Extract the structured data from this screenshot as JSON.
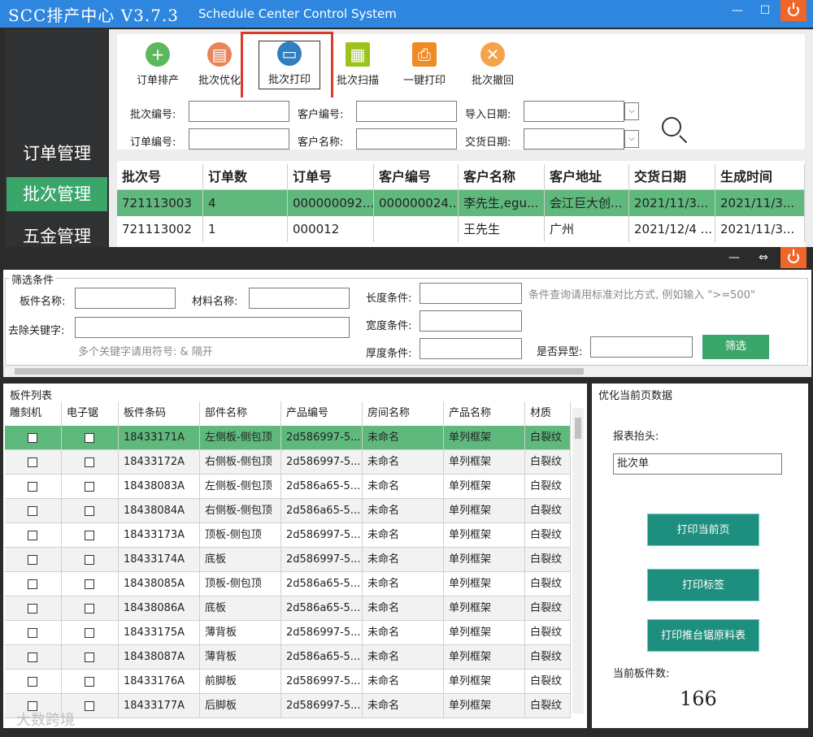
{
  "app": {
    "title": "SCC排产中心 V3.7.3",
    "subtitle": "Schedule Center Control System"
  },
  "sidebar": {
    "items": [
      {
        "label": "订单管理"
      },
      {
        "label": "批次管理"
      },
      {
        "label": "五金管理"
      }
    ]
  },
  "toolbar": {
    "items": [
      {
        "label": "订单排产",
        "icon": "plus-icon",
        "color": "#5cb85c"
      },
      {
        "label": "批次优化",
        "icon": "optimize-icon",
        "color": "#e8845a"
      },
      {
        "label": "批次打印",
        "icon": "monitor-print-icon",
        "color": "#2f7fc1"
      },
      {
        "label": "批次扫描",
        "icon": "barcode-icon",
        "color": "#9bc41e"
      },
      {
        "label": "一键打印",
        "icon": "printer-icon",
        "color": "#f08a24"
      },
      {
        "label": "批次撤回",
        "icon": "cancel-icon",
        "color": "#f4a24c"
      }
    ]
  },
  "search": {
    "batch_no_label": "批次编号:",
    "customer_no_label": "客户编号:",
    "import_date_label": "导入日期:",
    "order_no_label": "订单编号:",
    "customer_name_label": "客户名称:",
    "delivery_date_label": "交货日期:",
    "dropdown_glyph": "⌵"
  },
  "batch_table": {
    "columns": [
      "批次号",
      "订单数",
      "订单号",
      "客户编号",
      "客户名称",
      "客户地址",
      "交货日期",
      "生成时间"
    ],
    "rows": [
      [
        "721113003",
        "4",
        "000000092...",
        "000000024...",
        "李先生,egu...",
        "会江巨大创...",
        "2021/11/3...",
        "2021/11/3..."
      ],
      [
        "721113002",
        "1",
        "000012",
        "",
        "王先生",
        "广州",
        "2021/12/4 ...",
        "2021/11/3..."
      ]
    ]
  },
  "filter": {
    "group_title": "筛选条件",
    "part_name_label": "板件名称:",
    "material_name_label": "材料名称:",
    "remove_keyword_label": "去除关键字:",
    "keyword_hint": "多个关键字请用符号: & 隔开",
    "length_label": "长度条件:",
    "width_label": "宽度条件:",
    "thickness_label": "厚度条件:",
    "condition_hint": "条件查询请用标准对比方式, 例如输入 \">=500\"",
    "is_irregular_label": "是否异型:",
    "filter_button": "筛选"
  },
  "parts_list": {
    "title": "板件列表",
    "columns": [
      "雕刻机",
      "电子锯",
      "板件条码",
      "部件名称",
      "产品编号",
      "房间名称",
      "产品名称",
      "材质"
    ],
    "rows": [
      [
        "18433171A",
        "左侧板-侧包顶",
        "2d586997-5...",
        "未命名",
        "单列框架",
        "白裂纹"
      ],
      [
        "18433172A",
        "右侧板-侧包顶",
        "2d586997-5...",
        "未命名",
        "单列框架",
        "白裂纹"
      ],
      [
        "18438083A",
        "左侧板-侧包顶",
        "2d586a65-5...",
        "未命名",
        "单列框架",
        "白裂纹"
      ],
      [
        "18438084A",
        "右侧板-侧包顶",
        "2d586a65-5...",
        "未命名",
        "单列框架",
        "白裂纹"
      ],
      [
        "18433173A",
        "顶板-侧包顶",
        "2d586997-5...",
        "未命名",
        "单列框架",
        "白裂纹"
      ],
      [
        "18433174A",
        "底板",
        "2d586997-5...",
        "未命名",
        "单列框架",
        "白裂纹"
      ],
      [
        "18438085A",
        "顶板-侧包顶",
        "2d586a65-5...",
        "未命名",
        "单列框架",
        "白裂纹"
      ],
      [
        "18438086A",
        "底板",
        "2d586a65-5...",
        "未命名",
        "单列框架",
        "白裂纹"
      ],
      [
        "18433175A",
        "薄背板",
        "2d586997-5...",
        "未命名",
        "单列框架",
        "白裂纹"
      ],
      [
        "18438087A",
        "薄背板",
        "2d586a65-5...",
        "未命名",
        "单列框架",
        "白裂纹"
      ],
      [
        "18433176A",
        "前脚板",
        "2d586997-5...",
        "未命名",
        "单列框架",
        "白裂纹"
      ],
      [
        "18433177A",
        "后脚板",
        "2d586997-5...",
        "未命名",
        "单列框架",
        "白裂纹"
      ]
    ]
  },
  "optimize_panel": {
    "title": "优化当前页数据",
    "report_header_label": "报表抬头:",
    "report_header_value": "批次单",
    "print_current_page": "打印当前页",
    "print_labels": "打印标签",
    "print_saw_material": "打印推台锯原料表",
    "part_count_label": "当前板件数:",
    "part_count_value": "166"
  },
  "watermark": "大数跨境"
}
